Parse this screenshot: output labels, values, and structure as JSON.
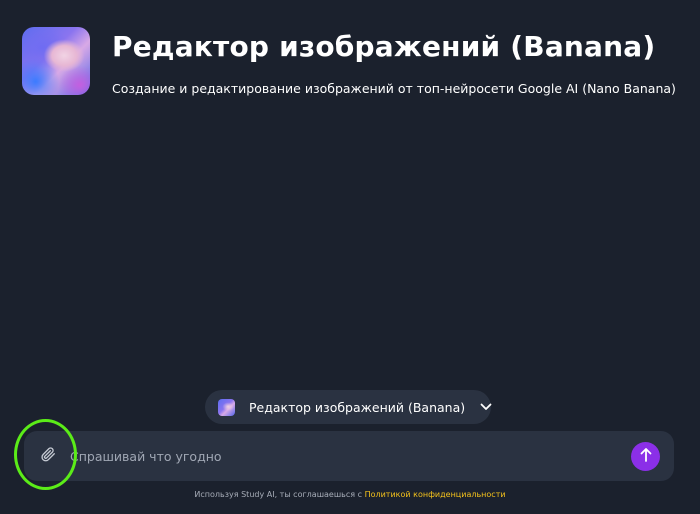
{
  "header": {
    "title": "Редактор изображений (Banana)",
    "subtitle": "Создание и редактирование изображений от топ-нейросети Google AI (Nano Banana)"
  },
  "model_selector": {
    "label": "Редактор изображений (Banana)",
    "icon": "chevron-down-icon"
  },
  "composer": {
    "placeholder": "Спрашивай что угодно",
    "value": "",
    "attach_icon": "paperclip-icon",
    "send_icon": "arrow-up-icon"
  },
  "footer": {
    "prefix": "Используя Study AI, ты соглашаешься с",
    "link_text": "Политикой конфиденциальности"
  },
  "colors": {
    "background": "#1b212d",
    "panel": "#2a3241",
    "send_button": "#8b2fe8",
    "link": "#f4c21c",
    "annotation": "#5bec18"
  }
}
